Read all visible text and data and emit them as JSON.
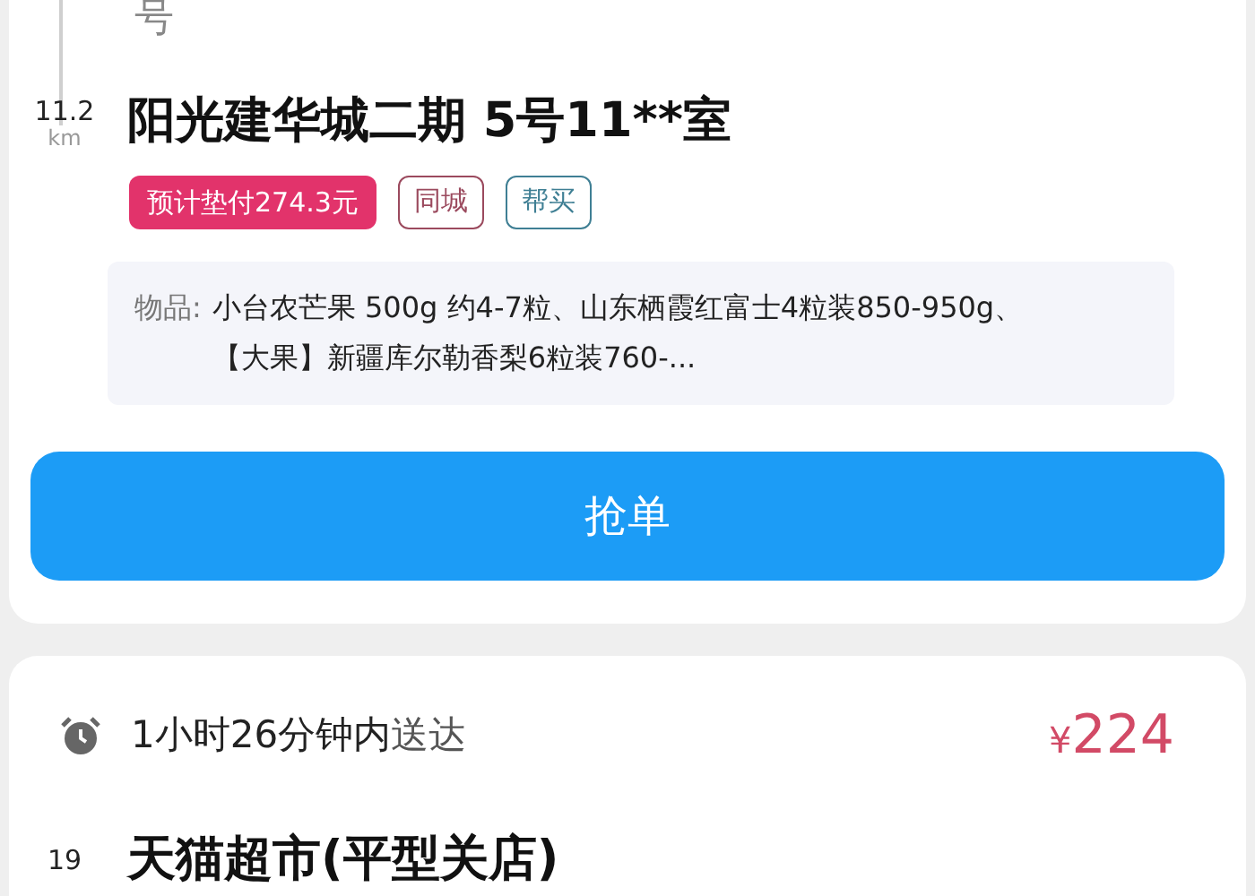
{
  "prev_stop": {
    "address_tail": "号"
  },
  "order": {
    "distance": "11.2",
    "distance_unit": "km",
    "address": "阳光建华城二期 5号11**室",
    "tags": [
      {
        "kind": "advance",
        "label": "预计垫付274.3元"
      },
      {
        "kind": "outline",
        "label": "同城",
        "color": "#9b4a5e"
      },
      {
        "kind": "outline",
        "label": "帮买",
        "color": "#3f7f94"
      }
    ],
    "items_label": "物品:",
    "items_text": "小台农芒果 500g 约4-7粒、山东栖霞红富士4粒装850-950g、【大果】新疆库尔勒香梨6粒装760-...",
    "grab_button": "抢单"
  },
  "next_order": {
    "eta": "1小时26分钟内",
    "eta_suffix": "送达",
    "currency": "¥",
    "price": "224",
    "distance": "19",
    "shop": "天猫超市(平型关店)"
  }
}
